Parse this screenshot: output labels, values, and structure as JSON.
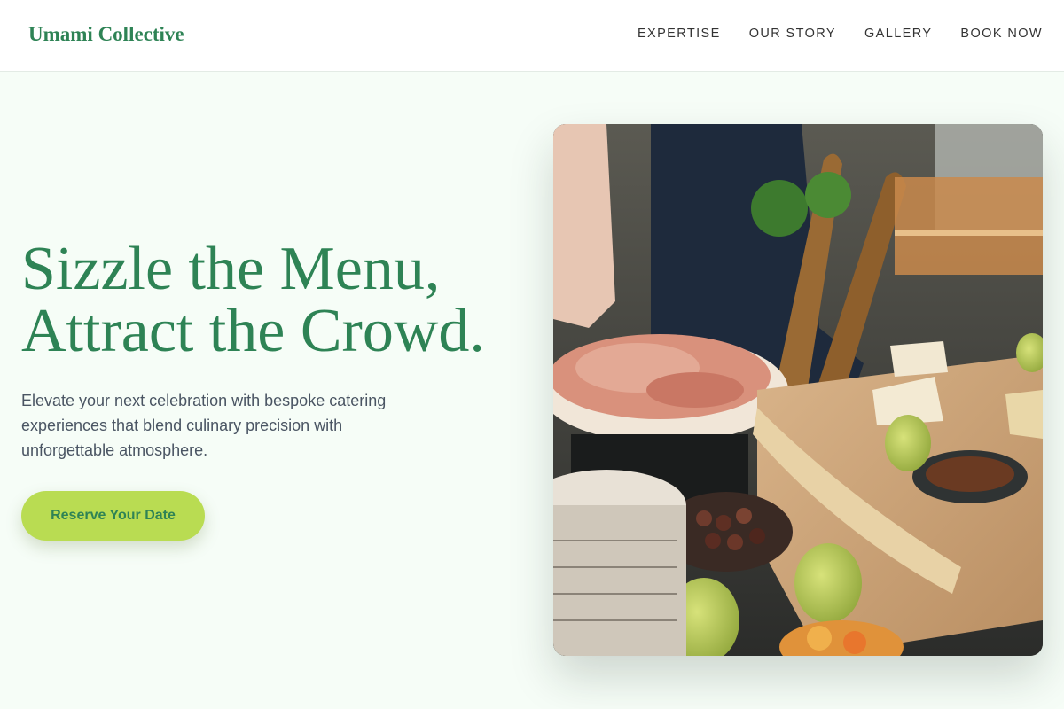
{
  "header": {
    "logo": "Umami Collective",
    "nav": [
      {
        "label": "EXPERTISE"
      },
      {
        "label": "OUR STORY"
      },
      {
        "label": "GALLERY"
      },
      {
        "label": "BOOK NOW"
      }
    ]
  },
  "hero": {
    "headline_line1": "Sizzle the Menu,",
    "headline_line2": "Attract the Crowd.",
    "subtext": "Elevate your next celebration with bespoke catering experiences that blend culinary precision with unforgettable atmosphere.",
    "cta_label": "Reserve Your Date"
  },
  "colors": {
    "brand_green": "#2e8355",
    "accent_lime": "#b9dc52",
    "background": "#f6fdf7"
  }
}
